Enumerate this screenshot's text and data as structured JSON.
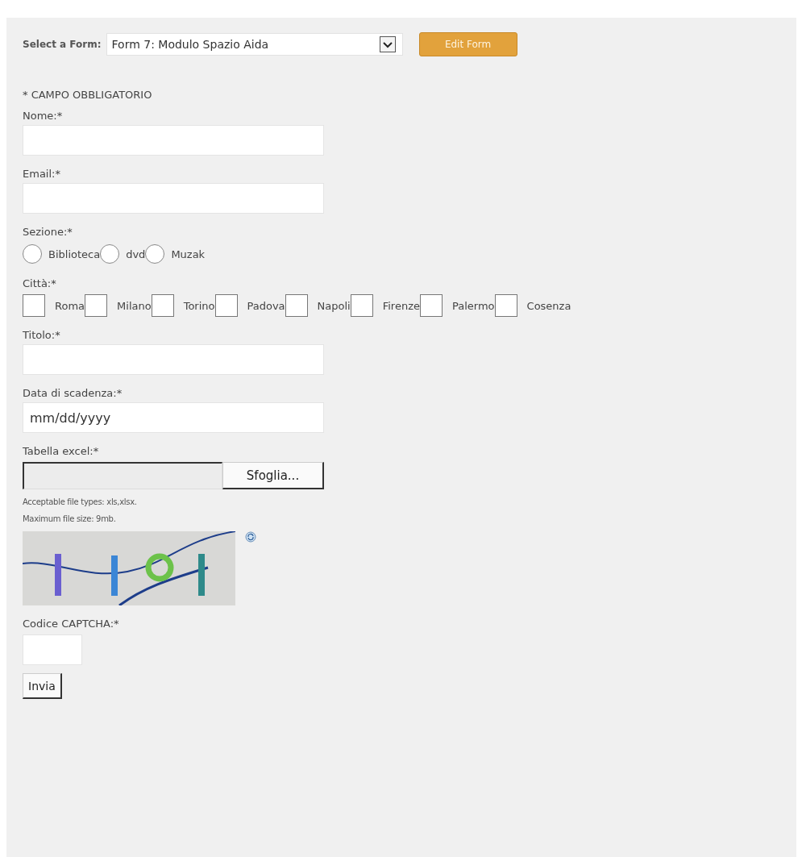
{
  "form_selector": {
    "label": "Select a Form:",
    "value": "Form 7: Modulo Spazio Aida",
    "button": "Edit Form"
  },
  "required_note": "* CAMPO OBBLIGATORIO",
  "fields": [
    {
      "kind": "text",
      "label": "Nome:*"
    },
    {
      "kind": "text",
      "label": "Email:*"
    },
    {
      "kind": "radio",
      "label": "Sezione:*",
      "options": [
        {
          "label": "Biblioteca",
          "selected": false
        },
        {
          "label": "dvd",
          "selected": false
        },
        {
          "label": "Muzak",
          "selected": false
        }
      ]
    },
    {
      "kind": "checkbox",
      "label": "Città:*",
      "options": [
        {
          "label": "Roma",
          "checked": false
        },
        {
          "label": "Milano",
          "checked": false
        },
        {
          "label": "Torino",
          "checked": false
        },
        {
          "label": "Padova",
          "checked": false
        },
        {
          "label": "Napoli",
          "checked": false
        },
        {
          "label": "Firenze",
          "checked": false
        },
        {
          "label": "Palermo",
          "checked": false
        },
        {
          "label": "Cosenza",
          "checked": false
        }
      ]
    },
    {
      "kind": "text",
      "label": "Titolo:*"
    },
    {
      "kind": "date",
      "label": "Data di scadenza:*",
      "placeholder": "mm/dd/yyyy"
    },
    {
      "kind": "file",
      "label": "Tabella excel:*",
      "button": "Sfoglia...",
      "notes": [
        "Acceptable file types: xls,xlsx.",
        "Maximum file size: 9mb."
      ]
    },
    {
      "kind": "captcha",
      "label": "Codice CAPTCHA:*"
    }
  ],
  "submit": "Invia"
}
